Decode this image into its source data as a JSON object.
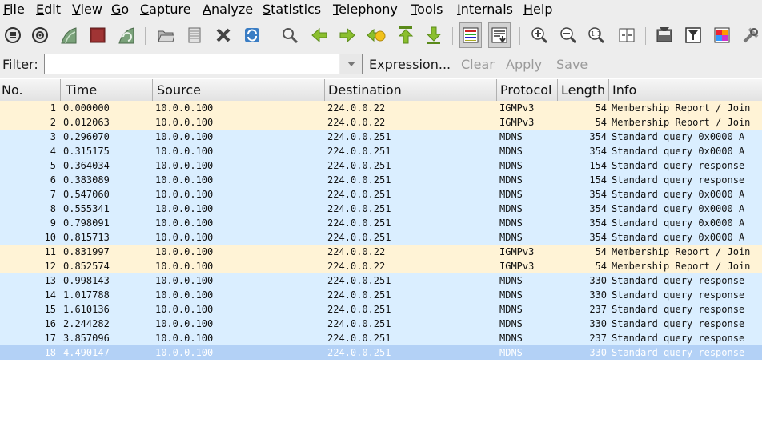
{
  "menu": [
    "File",
    "Edit",
    "View",
    "Go",
    "Capture",
    "Analyze",
    "Statistics",
    "Telephony",
    "Tools",
    "Internals",
    "Help"
  ],
  "toolbar": {
    "icons": [
      "interface-list-icon",
      "capture-options-icon",
      "start-capture-icon",
      "stop-capture-icon",
      "restart-capture-icon",
      "open-file-icon",
      "save-file-icon",
      "close-file-icon",
      "reload-icon",
      "find-packet-icon",
      "go-back-icon",
      "go-forward-icon",
      "go-to-packet-icon",
      "go-first-icon",
      "go-last-icon",
      "colorize-icon",
      "auto-scroll-icon",
      "zoom-in-icon",
      "zoom-out-icon",
      "normal-size-icon",
      "resize-columns-icon",
      "capture-filters-icon",
      "display-filters-icon",
      "coloring-rules-icon",
      "preferences-icon"
    ]
  },
  "filter": {
    "label": "Filter:",
    "value": "",
    "expression": "Expression...",
    "clear": "Clear",
    "apply": "Apply",
    "save": "Save"
  },
  "columns": [
    "No.",
    "Time",
    "Source",
    "Destination",
    "Protocol",
    "Length",
    "Info"
  ],
  "colors": {
    "igmp_row": "#fff3d6",
    "mdns_row": "#daeeff",
    "selected_row": "#b3d1f6"
  },
  "packets": [
    {
      "no": "1",
      "time": "0.000000",
      "src": "10.0.0.100",
      "dst": "224.0.0.22",
      "proto": "IGMPv3",
      "len": "54",
      "info": "Membership Report / Join",
      "kind": "igmp"
    },
    {
      "no": "2",
      "time": "0.012063",
      "src": "10.0.0.100",
      "dst": "224.0.0.22",
      "proto": "IGMPv3",
      "len": "54",
      "info": "Membership Report / Join",
      "kind": "igmp"
    },
    {
      "no": "3",
      "time": "0.296070",
      "src": "10.0.0.100",
      "dst": "224.0.0.251",
      "proto": "MDNS",
      "len": "354",
      "info": "Standard query 0x0000  A",
      "kind": "mdns"
    },
    {
      "no": "4",
      "time": "0.315175",
      "src": "10.0.0.100",
      "dst": "224.0.0.251",
      "proto": "MDNS",
      "len": "354",
      "info": "Standard query 0x0000  A",
      "kind": "mdns"
    },
    {
      "no": "5",
      "time": "0.364034",
      "src": "10.0.0.100",
      "dst": "224.0.0.251",
      "proto": "MDNS",
      "len": "154",
      "info": "Standard query response",
      "kind": "mdns"
    },
    {
      "no": "6",
      "time": "0.383089",
      "src": "10.0.0.100",
      "dst": "224.0.0.251",
      "proto": "MDNS",
      "len": "154",
      "info": "Standard query response",
      "kind": "mdns"
    },
    {
      "no": "7",
      "time": "0.547060",
      "src": "10.0.0.100",
      "dst": "224.0.0.251",
      "proto": "MDNS",
      "len": "354",
      "info": "Standard query 0x0000  A",
      "kind": "mdns"
    },
    {
      "no": "8",
      "time": "0.555341",
      "src": "10.0.0.100",
      "dst": "224.0.0.251",
      "proto": "MDNS",
      "len": "354",
      "info": "Standard query 0x0000  A",
      "kind": "mdns"
    },
    {
      "no": "9",
      "time": "0.798091",
      "src": "10.0.0.100",
      "dst": "224.0.0.251",
      "proto": "MDNS",
      "len": "354",
      "info": "Standard query 0x0000  A",
      "kind": "mdns"
    },
    {
      "no": "10",
      "time": "0.815713",
      "src": "10.0.0.100",
      "dst": "224.0.0.251",
      "proto": "MDNS",
      "len": "354",
      "info": "Standard query 0x0000  A",
      "kind": "mdns"
    },
    {
      "no": "11",
      "time": "0.831997",
      "src": "10.0.0.100",
      "dst": "224.0.0.22",
      "proto": "IGMPv3",
      "len": "54",
      "info": "Membership Report / Join",
      "kind": "igmp"
    },
    {
      "no": "12",
      "time": "0.852574",
      "src": "10.0.0.100",
      "dst": "224.0.0.22",
      "proto": "IGMPv3",
      "len": "54",
      "info": "Membership Report / Join",
      "kind": "igmp"
    },
    {
      "no": "13",
      "time": "0.998143",
      "src": "10.0.0.100",
      "dst": "224.0.0.251",
      "proto": "MDNS",
      "len": "330",
      "info": "Standard query response",
      "kind": "mdns"
    },
    {
      "no": "14",
      "time": "1.017788",
      "src": "10.0.0.100",
      "dst": "224.0.0.251",
      "proto": "MDNS",
      "len": "330",
      "info": "Standard query response",
      "kind": "mdns"
    },
    {
      "no": "15",
      "time": "1.610136",
      "src": "10.0.0.100",
      "dst": "224.0.0.251",
      "proto": "MDNS",
      "len": "237",
      "info": "Standard query response",
      "kind": "mdns"
    },
    {
      "no": "16",
      "time": "2.244282",
      "src": "10.0.0.100",
      "dst": "224.0.0.251",
      "proto": "MDNS",
      "len": "330",
      "info": "Standard query response",
      "kind": "mdns"
    },
    {
      "no": "17",
      "time": "3.857096",
      "src": "10.0.0.100",
      "dst": "224.0.0.251",
      "proto": "MDNS",
      "len": "237",
      "info": "Standard query response",
      "kind": "mdns"
    },
    {
      "no": "18",
      "time": "4.490147",
      "src": "10.0.0.100",
      "dst": "224.0.0.251",
      "proto": "MDNS",
      "len": "330",
      "info": "Standard query response",
      "kind": "mdns",
      "selected": true
    }
  ]
}
